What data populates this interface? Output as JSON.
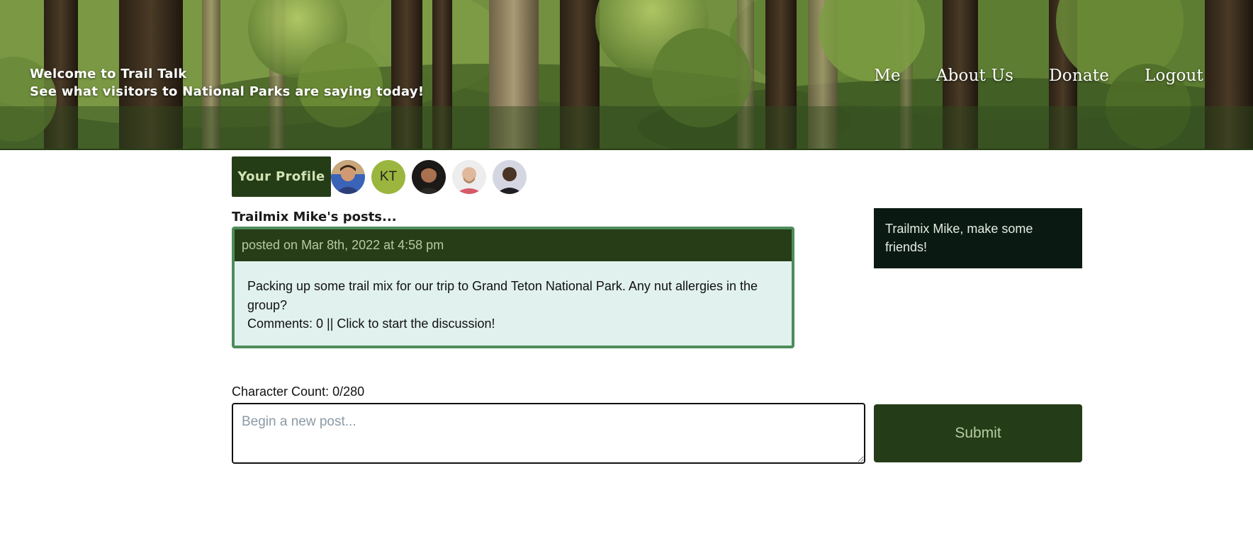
{
  "header": {
    "welcome_line1": "Welcome to Trail Talk",
    "welcome_line2": "See what visitors to National Parks are saying today!",
    "nav": [
      {
        "label": "Me"
      },
      {
        "label": "About Us"
      },
      {
        "label": "Donate"
      },
      {
        "label": "Logout"
      }
    ]
  },
  "profile": {
    "button_label": "Your Profile",
    "friends": [
      {
        "type": "photo",
        "icon": "avatar-photo-icon"
      },
      {
        "type": "initials",
        "initials": "KT"
      },
      {
        "type": "photo",
        "icon": "avatar-photo-icon"
      },
      {
        "type": "photo",
        "icon": "avatar-photo-icon"
      },
      {
        "type": "photo",
        "icon": "avatar-photo-icon"
      }
    ]
  },
  "posts": {
    "heading": "Trailmix Mike's posts...",
    "items": [
      {
        "date": "posted on Mar 8th, 2022 at 4:58 pm",
        "text": "Packing up some trail mix for our trip to Grand Teton National Park. Any nut allergies in the group?",
        "comments": "Comments: 0 || Click to start the discussion!"
      }
    ]
  },
  "side_note": "Trailmix Mike, make some friends!",
  "composer": {
    "char_count": "Character Count: 0/280",
    "placeholder": "Begin a new post...",
    "submit_label": "Submit"
  },
  "colors": {
    "dark_green": "#253d17",
    "post_border": "#4e8c5a",
    "post_body": "#e0f1ee",
    "side_note_bg": "#0a1a12"
  }
}
